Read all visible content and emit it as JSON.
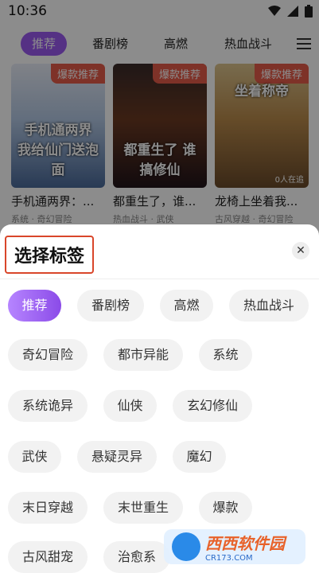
{
  "status": {
    "time": "10:36"
  },
  "top_tabs": [
    {
      "label": "推荐",
      "active": true
    },
    {
      "label": "番剧榜",
      "active": false
    },
    {
      "label": "高燃",
      "active": false
    },
    {
      "label": "热血战斗",
      "active": false
    }
  ],
  "cards": [
    {
      "badge": "爆款推荐",
      "cover_title": "手机通两界 我给仙门送泡面",
      "name": "手机通两界：...",
      "sub": "系统 · 奇幻冒险",
      "reads": ""
    },
    {
      "badge": "爆款推荐",
      "cover_title": "都重生了 谁搞修仙",
      "name": "都重生了，谁...",
      "sub": "热血战斗 · 武侠",
      "reads": ""
    },
    {
      "badge": "爆款推荐",
      "cover_title": "坐着称帝",
      "name": "龙椅上坐着我...",
      "sub": "古风穿越 · 奇幻冒险",
      "reads": "0人在追"
    }
  ],
  "sheet": {
    "title": "选择标签",
    "close": "✕",
    "tags": [
      "推荐",
      "番剧榜",
      "高燃",
      "热血战斗",
      "奇幻冒险",
      "都市异能",
      "系统",
      "系统诡异",
      "仙侠",
      "玄幻修仙",
      "武侠",
      "悬疑灵异",
      "魔幻",
      "末日穿越",
      "末世重生",
      "爆款",
      "古风甜宠",
      "治愈系"
    ],
    "selected_tag": "推荐"
  },
  "watermark": {
    "text": "西西软件园",
    "url": "CR173.COM"
  },
  "colors": {
    "accent": "#9b59f0",
    "badge": "#e55b4a",
    "highlight_box": "#d9462a"
  }
}
